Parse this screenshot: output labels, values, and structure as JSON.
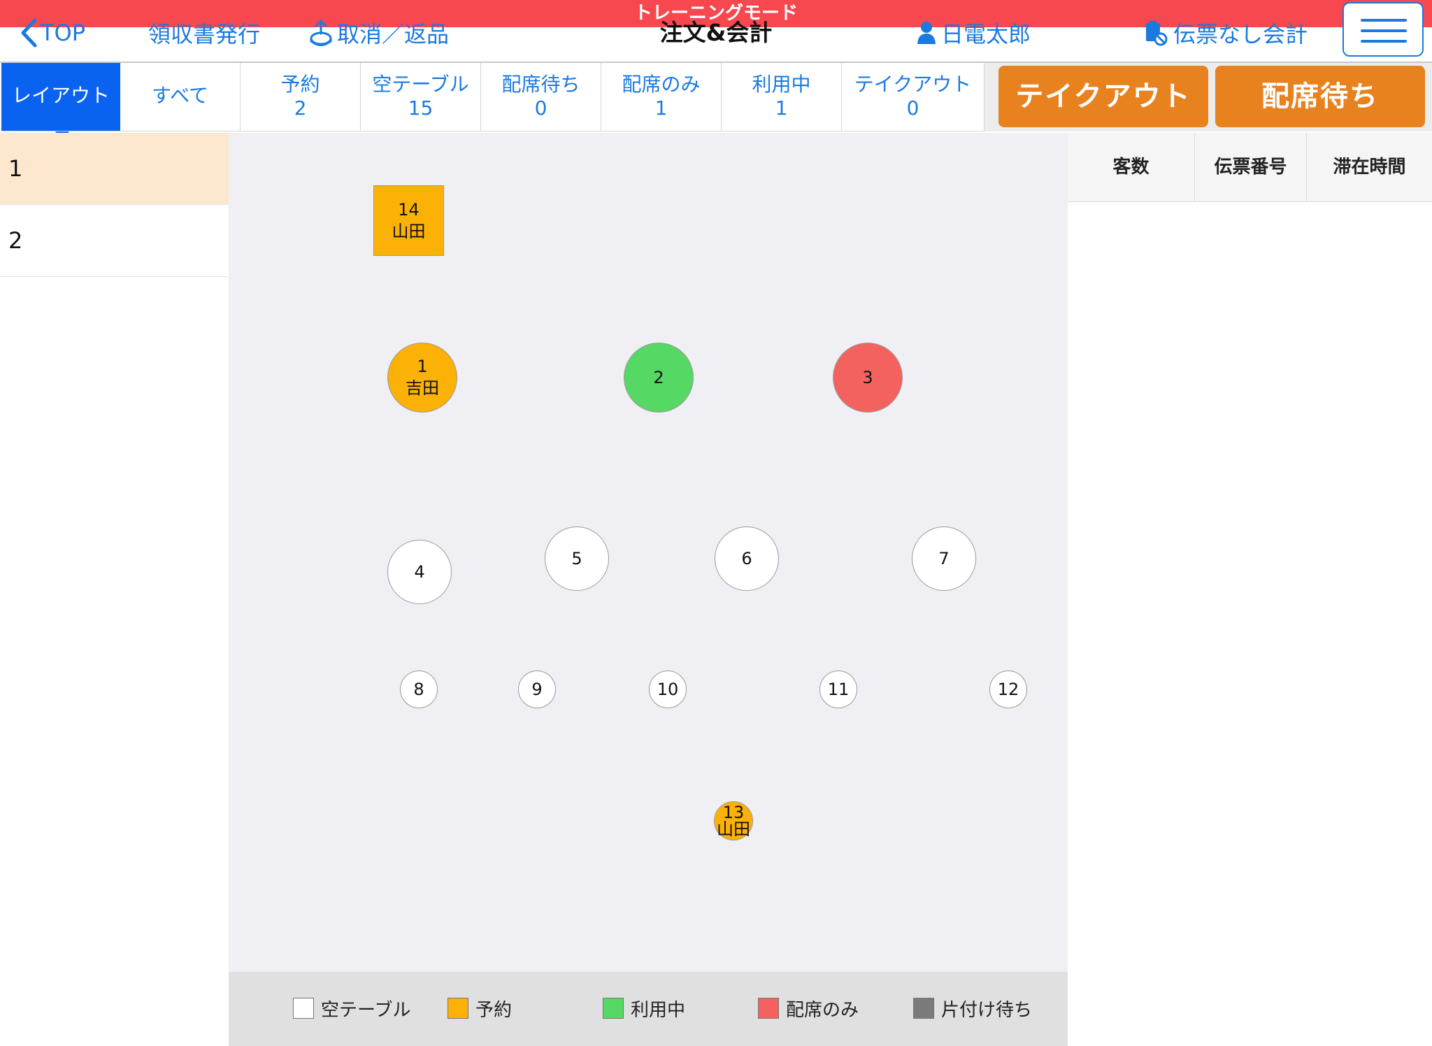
{
  "header": {
    "training_mode": "トレーニングモード",
    "back_label": "TOP",
    "receipt_label": "領収書発行",
    "cancel_return_label": "取消／返品",
    "title": "注文&会計",
    "staff_name": "日電太郎",
    "no_slip_label": "伝票なし会計",
    "accent_color": "#1a7ae0",
    "banner_color": "#f7474f"
  },
  "tabs": [
    {
      "label": "レイアウト",
      "count": null
    },
    {
      "label": "すべて",
      "count": null
    },
    {
      "label": "予約",
      "count": "2"
    },
    {
      "label": "空テーブル",
      "count": "15"
    },
    {
      "label": "配席待ち",
      "count": "0"
    },
    {
      "label": "配席のみ",
      "count": "1"
    },
    {
      "label": "利用中",
      "count": "1"
    },
    {
      "label": "テイクアウト",
      "count": "0"
    }
  ],
  "actions": {
    "takeout_label": "テイクアウト",
    "waiting_label": "配席待ち",
    "button_color": "#e8821f"
  },
  "floors": [
    "1",
    "2"
  ],
  "selected_floor": "1",
  "tables": [
    {
      "name": "14",
      "guest": "山田",
      "status": "reserved",
      "shape": "square"
    },
    {
      "name": "1",
      "guest": "吉田",
      "status": "reserved",
      "shape": "round"
    },
    {
      "name": "2",
      "guest": "",
      "status": "in-use",
      "shape": "round"
    },
    {
      "name": "3",
      "guest": "",
      "status": "seated",
      "shape": "round"
    },
    {
      "name": "4",
      "guest": "",
      "status": "empty",
      "shape": "round"
    },
    {
      "name": "5",
      "guest": "",
      "status": "empty",
      "shape": "round"
    },
    {
      "name": "6",
      "guest": "",
      "status": "empty",
      "shape": "round"
    },
    {
      "name": "7",
      "guest": "",
      "status": "empty",
      "shape": "round"
    },
    {
      "name": "8",
      "guest": "",
      "status": "empty",
      "shape": "round"
    },
    {
      "name": "9",
      "guest": "",
      "status": "empty",
      "shape": "round"
    },
    {
      "name": "10",
      "guest": "",
      "status": "empty",
      "shape": "round"
    },
    {
      "name": "11",
      "guest": "",
      "status": "empty",
      "shape": "round"
    },
    {
      "name": "12",
      "guest": "",
      "status": "empty",
      "shape": "round"
    },
    {
      "name": "13",
      "guest": "山田",
      "status": "reserved",
      "shape": "round"
    }
  ],
  "legend": [
    {
      "label": "空テーブル",
      "color": "#ffffff"
    },
    {
      "label": "予約",
      "color": "#fbb105"
    },
    {
      "label": "利用中",
      "color": "#55d864"
    },
    {
      "label": "配席のみ",
      "color": "#f4625f"
    },
    {
      "label": "片付け待ち",
      "color": "#7a7a7a"
    }
  ],
  "slip_columns": [
    "客数",
    "伝票番号",
    "滞在時間"
  ]
}
